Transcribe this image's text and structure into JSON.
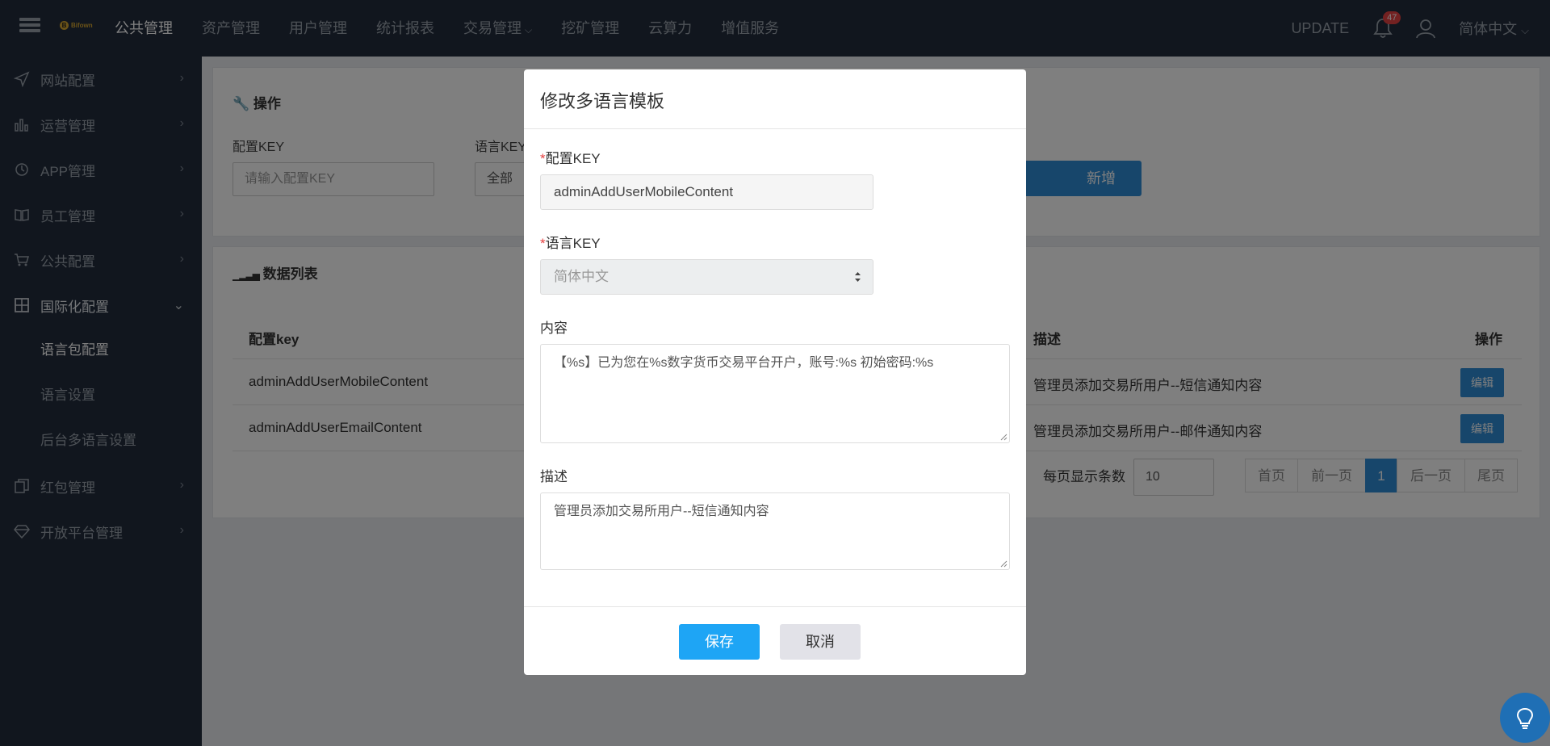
{
  "topbar": {
    "logo_text": "Bifown",
    "nav": [
      {
        "label": "公共管理",
        "active": true
      },
      {
        "label": "资产管理"
      },
      {
        "label": "用户管理"
      },
      {
        "label": "统计报表"
      },
      {
        "label": "交易管理",
        "dropdown": true
      },
      {
        "label": "挖矿管理"
      },
      {
        "label": "云算力"
      },
      {
        "label": "增值服务"
      }
    ],
    "update_label": "UPDATE",
    "notification_count": "47",
    "language": "简体中文"
  },
  "sidebar": {
    "items": [
      {
        "label": "网站配置",
        "icon": "send-icon"
      },
      {
        "label": "运营管理",
        "icon": "bar-chart-icon"
      },
      {
        "label": "APP管理",
        "icon": "history-icon"
      },
      {
        "label": "员工管理",
        "icon": "book-icon"
      },
      {
        "label": "公共配置",
        "icon": "cart-icon"
      },
      {
        "label": "国际化配置",
        "icon": "calculator-icon",
        "open": true
      },
      {
        "label": "红包管理",
        "icon": "copy-icon"
      },
      {
        "label": "开放平台管理",
        "icon": "diamond-icon"
      }
    ],
    "subitems": [
      "语言包配置",
      "语言设置",
      "后台多语言设置"
    ]
  },
  "operations": {
    "title": "操作",
    "config_key_label": "配置KEY",
    "config_key_placeholder": "请输入配置KEY",
    "lang_key_label": "语言KEY",
    "lang_key_value": "全部",
    "add_button": "新增"
  },
  "data_list": {
    "title": "数据列表",
    "headers": {
      "key": "配置key",
      "desc": "描述",
      "action": "操作"
    },
    "rows": [
      {
        "key": "adminAddUserMobileContent",
        "desc": "管理员添加交易所用户--短信通知内容",
        "action": "编辑"
      },
      {
        "key": "adminAddUserEmailContent",
        "desc": "管理员添加交易所用户--邮件通知内容",
        "action": "编辑"
      }
    ],
    "page_size_label": "每页显示条数",
    "page_size": "10",
    "pager": {
      "first": "首页",
      "prev": "前一页",
      "current": "1",
      "next": "后一页",
      "last": "尾页"
    }
  },
  "modal": {
    "title": "修改多语言模板",
    "config_key_label": "配置KEY",
    "config_key_value": "adminAddUserMobileContent",
    "lang_key_label": "语言KEY",
    "lang_key_value": "简体中文",
    "content_label": "内容",
    "content_value": "【%s】已为您在%s数字货币交易平台开户，账号:%s  初始密码:%s",
    "desc_label": "描述",
    "desc_value": "管理员添加交易所用户--短信通知内容",
    "required_mark": "*",
    "save_button": "保存",
    "cancel_button": "取消"
  },
  "colors": {
    "topbar_bg": "#222c3c",
    "primary": "#2e8cd6",
    "save": "#1ea5f5",
    "badge": "#e64242"
  }
}
